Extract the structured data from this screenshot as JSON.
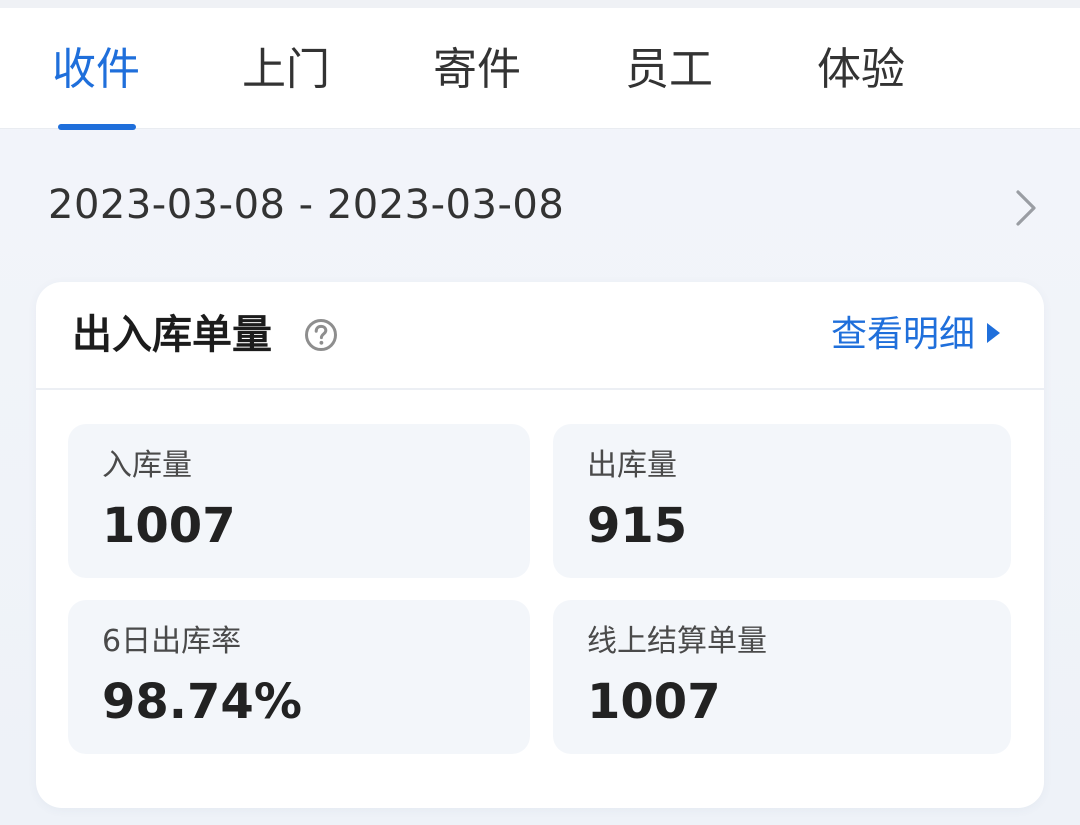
{
  "tabs": [
    {
      "label": "收件",
      "active": true
    },
    {
      "label": "上门",
      "active": false
    },
    {
      "label": "寄件",
      "active": false
    },
    {
      "label": "员工",
      "active": false
    },
    {
      "label": "体验",
      "active": false
    }
  ],
  "date_range": {
    "text": "2023-03-08 - 2023-03-08"
  },
  "card": {
    "title": "出入库单量",
    "detail_link": "查看明细",
    "stats": [
      {
        "label": "入库量",
        "value": "1007"
      },
      {
        "label": "出库量",
        "value": "915"
      },
      {
        "label": "6日出库率",
        "value": "98.74%"
      },
      {
        "label": "线上结算单量",
        "value": "1007"
      }
    ]
  },
  "colors": {
    "accent": "#1f6fdb",
    "text": "#222222",
    "stat_bg": "#f3f6fa"
  },
  "icons": {
    "date_row": "chevron-right-icon",
    "title_help": "help-circle-icon",
    "detail_link": "caret-right-icon"
  }
}
